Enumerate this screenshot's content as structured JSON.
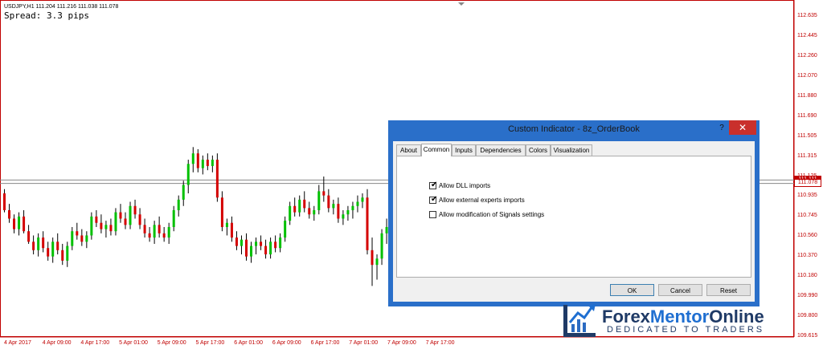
{
  "chart": {
    "symbol_info": "USDJPY,H1  111.204 111.216 111.038 111.078",
    "spread": "Spread: 3.3 pips",
    "current_price": "111.111",
    "bid_price": "111.078",
    "price_scale": [
      "112.635",
      "112.445",
      "112.260",
      "112.070",
      "111.880",
      "111.690",
      "111.505",
      "111.315",
      "111.125",
      "110.935",
      "110.745",
      "110.560",
      "110.370",
      "110.180",
      "109.990",
      "109.800",
      "109.615"
    ],
    "time_scale": [
      "4 Apr 2017",
      "4 Apr 09:00",
      "4 Apr 17:00",
      "5 Apr 01:00",
      "5 Apr 09:00",
      "5 Apr 17:00",
      "6 Apr 01:00",
      "6 Apr 09:00",
      "6 Apr 17:00",
      "7 Apr 01:00",
      "7 Apr 09:00",
      "7 Apr 17:00"
    ],
    "colors": {
      "bull": "#00c000",
      "bear": "#d40000",
      "wick": "#000000",
      "axis": "#c00000",
      "level": "#888888"
    }
  },
  "chart_data": {
    "type": "candlestick",
    "symbol": "USDJPY",
    "timeframe": "H1",
    "ohlc": [
      [
        110.98,
        111.02,
        110.8,
        110.82
      ],
      [
        110.82,
        110.88,
        110.7,
        110.74
      ],
      [
        110.74,
        110.78,
        110.6,
        110.64
      ],
      [
        110.64,
        110.8,
        110.58,
        110.76
      ],
      [
        110.76,
        110.82,
        110.6,
        110.62
      ],
      [
        110.62,
        110.68,
        110.5,
        110.52
      ],
      [
        110.52,
        110.58,
        110.4,
        110.44
      ],
      [
        110.44,
        110.6,
        110.38,
        110.56
      ],
      [
        110.56,
        110.62,
        110.42,
        110.46
      ],
      [
        110.46,
        110.52,
        110.34,
        110.38
      ],
      [
        110.38,
        110.56,
        110.32,
        110.52
      ],
      [
        110.52,
        110.6,
        110.4,
        110.44
      ],
      [
        110.44,
        110.5,
        110.3,
        110.34
      ],
      [
        110.34,
        110.52,
        110.28,
        110.48
      ],
      [
        110.48,
        110.66,
        110.44,
        110.62
      ],
      [
        110.62,
        110.7,
        110.54,
        110.58
      ],
      [
        110.58,
        110.64,
        110.48,
        110.52
      ],
      [
        110.52,
        110.62,
        110.46,
        110.58
      ],
      [
        110.58,
        110.8,
        110.54,
        110.76
      ],
      [
        110.76,
        110.82,
        110.66,
        110.7
      ],
      [
        110.7,
        110.78,
        110.6,
        110.64
      ],
      [
        110.64,
        110.72,
        110.56,
        110.68
      ],
      [
        110.68,
        110.74,
        110.58,
        110.62
      ],
      [
        110.62,
        110.84,
        110.58,
        110.8
      ],
      [
        110.8,
        110.88,
        110.7,
        110.74
      ],
      [
        110.74,
        110.8,
        110.64,
        110.68
      ],
      [
        110.68,
        110.9,
        110.64,
        110.86
      ],
      [
        110.86,
        110.92,
        110.74,
        110.78
      ],
      [
        110.78,
        110.84,
        110.64,
        110.68
      ],
      [
        110.68,
        110.74,
        110.56,
        110.6
      ],
      [
        110.6,
        110.66,
        110.52,
        110.56
      ],
      [
        110.56,
        110.72,
        110.5,
        110.68
      ],
      [
        110.68,
        110.76,
        110.56,
        110.6
      ],
      [
        110.6,
        110.66,
        110.52,
        110.56
      ],
      [
        110.56,
        110.7,
        110.5,
        110.66
      ],
      [
        110.66,
        110.86,
        110.62,
        110.82
      ],
      [
        110.82,
        110.96,
        110.76,
        110.92
      ],
      [
        110.92,
        111.1,
        110.86,
        111.06
      ],
      [
        111.06,
        111.3,
        110.98,
        111.26
      ],
      [
        111.26,
        111.42,
        111.18,
        111.36
      ],
      [
        111.36,
        111.4,
        111.18,
        111.22
      ],
      [
        111.22,
        111.34,
        111.16,
        111.3
      ],
      [
        111.3,
        111.36,
        111.2,
        111.24
      ],
      [
        111.24,
        111.34,
        111.18,
        111.3
      ],
      [
        111.3,
        111.36,
        110.9,
        110.94
      ],
      [
        110.94,
        111.0,
        110.62,
        110.66
      ],
      [
        110.66,
        110.74,
        110.58,
        110.7
      ],
      [
        110.7,
        110.76,
        110.52,
        110.56
      ],
      [
        110.56,
        110.62,
        110.44,
        110.48
      ],
      [
        110.48,
        110.58,
        110.4,
        110.54
      ],
      [
        110.54,
        110.6,
        110.34,
        110.38
      ],
      [
        110.38,
        110.52,
        110.32,
        110.48
      ],
      [
        110.48,
        110.56,
        110.4,
        110.52
      ],
      [
        110.52,
        110.58,
        110.44,
        110.48
      ],
      [
        110.48,
        110.54,
        110.36,
        110.4
      ],
      [
        110.4,
        110.56,
        110.36,
        110.52
      ],
      [
        110.52,
        110.58,
        110.42,
        110.46
      ],
      [
        110.46,
        110.6,
        110.42,
        110.56
      ],
      [
        110.56,
        110.76,
        110.52,
        110.72
      ],
      [
        110.72,
        110.9,
        110.68,
        110.86
      ],
      [
        110.86,
        110.94,
        110.76,
        110.8
      ],
      [
        110.8,
        110.96,
        110.76,
        110.92
      ],
      [
        110.92,
        111.0,
        110.8,
        110.84
      ],
      [
        110.84,
        110.9,
        110.74,
        110.78
      ],
      [
        110.78,
        110.86,
        110.72,
        110.82
      ],
      [
        110.82,
        111.06,
        110.78,
        111.0
      ],
      [
        111.0,
        111.14,
        110.9,
        110.96
      ],
      [
        110.96,
        111.02,
        110.8,
        110.84
      ],
      [
        110.84,
        110.92,
        110.78,
        110.88
      ],
      [
        110.88,
        110.94,
        110.7,
        110.74
      ],
      [
        110.74,
        110.82,
        110.68,
        110.78
      ],
      [
        110.78,
        110.86,
        110.72,
        110.82
      ],
      [
        110.82,
        110.9,
        110.74,
        110.86
      ],
      [
        110.86,
        110.96,
        110.8,
        110.9
      ],
      [
        110.9,
        110.98,
        110.84,
        110.94
      ],
      [
        110.94,
        111.02,
        110.4,
        110.44
      ],
      [
        110.44,
        110.56,
        110.1,
        110.3
      ],
      [
        110.3,
        110.4,
        110.16,
        110.36
      ],
      [
        110.36,
        110.64,
        110.3,
        110.6
      ],
      [
        110.6,
        110.74,
        110.5,
        110.66
      ]
    ],
    "ylim": [
      109.615,
      112.635
    ],
    "horizontal_levels": [
      111.111,
      111.078
    ],
    "xlabel": "",
    "ylabel": ""
  },
  "dialog": {
    "title": "Custom Indicator - 8z_OrderBook",
    "help_label": "?",
    "close_label": "✕",
    "tabs": [
      "About",
      "Common",
      "Inputs",
      "Dependencies",
      "Colors",
      "Visualization"
    ],
    "active_tab": "Common",
    "checkboxes": [
      {
        "label": "Allow DLL imports",
        "checked": true
      },
      {
        "label": "Allow external experts imports",
        "checked": true
      },
      {
        "label": "Allow modification of Signals settings",
        "checked": false
      }
    ],
    "buttons": {
      "ok": "OK",
      "cancel": "Cancel",
      "reset": "Reset"
    }
  },
  "logo": {
    "brand_part1": "Forex",
    "brand_part2": "Mentor",
    "brand_part3": "Online",
    "tagline": "DEDICATED TO TRADERS",
    "colors": {
      "dark": "#1f3a66",
      "blue": "#1f6fd1",
      "arrow": "#2b6bc2"
    }
  }
}
